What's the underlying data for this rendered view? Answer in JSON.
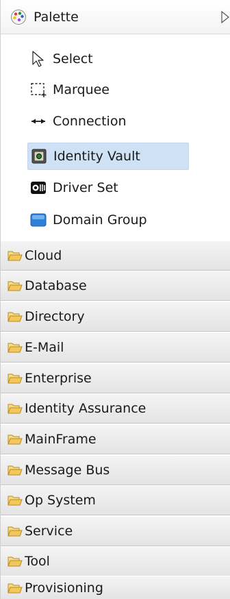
{
  "palette": {
    "title": "Palette",
    "tools": [
      {
        "label": "Select",
        "icon": "pointer-arrow-icon"
      },
      {
        "label": "Marquee",
        "icon": "marquee-icon"
      },
      {
        "label": "Connection",
        "icon": "connection-icon"
      },
      {
        "label": "Identity Vault",
        "icon": "identity-vault-icon",
        "selected": true
      },
      {
        "label": "Driver Set",
        "icon": "driver-set-icon"
      },
      {
        "label": "Domain Group",
        "icon": "domain-group-icon"
      }
    ],
    "drawers": [
      {
        "label": "Cloud"
      },
      {
        "label": "Database"
      },
      {
        "label": "Directory"
      },
      {
        "label": "E-Mail"
      },
      {
        "label": "Enterprise"
      },
      {
        "label": "Identity Assurance"
      },
      {
        "label": "MainFrame"
      },
      {
        "label": "Message Bus"
      },
      {
        "label": "Op System"
      },
      {
        "label": "Service"
      },
      {
        "label": "Tool"
      },
      {
        "label": "Provisioning"
      }
    ]
  },
  "colors": {
    "selection": "#cfe1f5",
    "folder": "#f2c75c",
    "domain_group": "#2f7fd6"
  }
}
